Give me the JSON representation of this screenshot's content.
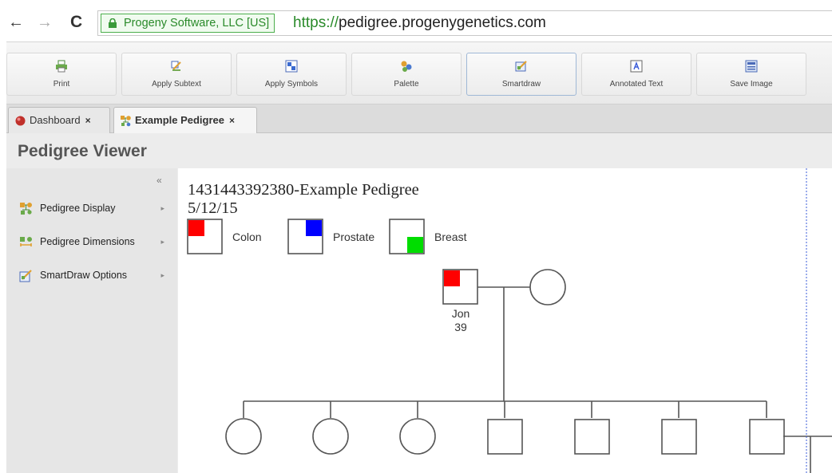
{
  "browser": {
    "cert_label": "Progeny Software, LLC [US]",
    "url_scheme": "https://",
    "url_host": "pedigree.progenygenetics.com",
    "nav_back": "←",
    "nav_forward": "→",
    "nav_reload": "C"
  },
  "toolbar": {
    "buttons": [
      {
        "label": "Print",
        "icon": "printer-icon"
      },
      {
        "label": "Apply Subtext",
        "icon": "subtext-icon"
      },
      {
        "label": "Apply Symbols",
        "icon": "symbols-icon"
      },
      {
        "label": "Palette",
        "icon": "palette-icon"
      },
      {
        "label": "Smartdraw",
        "icon": "smartdraw-icon"
      },
      {
        "label": "Annotated Text",
        "icon": "annotated-text-icon"
      },
      {
        "label": "Save Image",
        "icon": "save-image-icon"
      }
    ]
  },
  "tabs": [
    {
      "label": "Dashboard",
      "close": "×",
      "active": false
    },
    {
      "label": "Example Pedigree",
      "close": "×",
      "active": true
    }
  ],
  "panel": {
    "title": "Pedigree Viewer"
  },
  "sidebar": {
    "collapse": "«",
    "items": [
      {
        "label": "Pedigree Display",
        "arrow": "▸"
      },
      {
        "label": "Pedigree Dimensions",
        "arrow": "▸"
      },
      {
        "label": "SmartDraw Options",
        "arrow": "▸"
      }
    ]
  },
  "pedigree": {
    "title": "1431443392380-Example Pedigree",
    "date": "5/12/15",
    "legend": [
      {
        "label": "Colon",
        "color": "#ff0000",
        "quadrant": "top-left"
      },
      {
        "label": "Prostate",
        "color": "#0000ff",
        "quadrant": "top-right"
      },
      {
        "label": "Breast",
        "color": "#00dd00",
        "quadrant": "bottom-right"
      }
    ],
    "proband": {
      "name": "Jon",
      "age": "39",
      "condition": "Colon"
    },
    "children_sexes": [
      "female",
      "female",
      "female",
      "male",
      "male",
      "male",
      "male"
    ],
    "colors": {
      "line": "#555555",
      "accent_blue": "#3a5bd8",
      "secure_green": "#2a8a2a"
    }
  }
}
